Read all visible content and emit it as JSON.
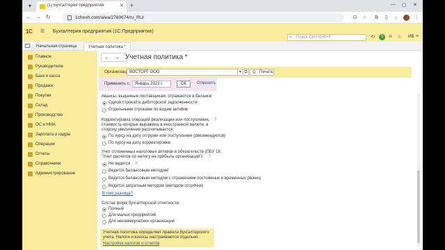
{
  "browser": {
    "tab_title": "(1) Бухгалтерия предприятия",
    "url": "1cfresh.com/a/ea/2780674/ru_RU/"
  },
  "app": {
    "logo": "1С",
    "title": "Бухгалтерия предприятия (1С:Предприятие)",
    "search_placeholder": "Поиск Ctrl+Shift+F",
    "notifications_count": "9",
    "user": "ИВ"
  },
  "tabs": [
    {
      "label": "Начальная страница"
    },
    {
      "label": "Учетная политика *"
    }
  ],
  "sidebar": {
    "items": [
      {
        "label": "Главное"
      },
      {
        "label": "Руководителю"
      },
      {
        "label": "Банк и касса"
      },
      {
        "label": "Продажи"
      },
      {
        "label": "Покупки"
      },
      {
        "label": "Склад"
      },
      {
        "label": "Производство"
      },
      {
        "label": "ОС и НМА"
      },
      {
        "label": "Зарплата и кадры"
      },
      {
        "label": "Операции"
      },
      {
        "label": "Отчеты"
      },
      {
        "label": "Справочники"
      },
      {
        "label": "Администрирование"
      }
    ]
  },
  "form": {
    "title": "Учетная политика *",
    "org_label": "Организация:",
    "org_value": "ВОСТОРГ ООО",
    "print_label": "Печать",
    "apply_label": "Применить с:",
    "apply_value": "Январь 2023 г.",
    "ok_label": "ОК",
    "cancel_label": "Отменить",
    "advances": {
      "title": "Авансы, выданные поставщикам, отражаются в балансе:",
      "options": [
        "Одной строкой в дебиторской задолженности",
        "Отдельными строками по видам активов"
      ]
    },
    "fx": {
      "title": "Корректировка операций реализации или поступления, стоимость которых выражена в иностранной валюте, в сторону увеличения рассчитывается:",
      "options": [
        "По курсу на дату отгрузки или поступления (рекомендуется)",
        "По курсу на дату корректировки"
      ]
    },
    "tax": {
      "title": "Учет отложенных налоговых активов и обязательств (ПБУ 18 \"Учет расчетов по налогу на прибыль организаций\"):",
      "options": [
        "Не ведется",
        "Ведется балансовым методом",
        "Ведется балансовым методом с отражением постоянных и временных разниц",
        "Ведется затратным методом (методом отсрочки)"
      ],
      "link": "В чем разница?"
    },
    "reports": {
      "title": "Состав форм бухгалтерской отчетности:",
      "options": [
        "Полный",
        "Для малых предприятий",
        "Для некоммерческих организаций"
      ]
    },
    "info": {
      "text": "Учетная политика определяет правила бухгалтерского учета. Налоги и взносы настраиваются отдельно.",
      "link": "Настройка налогов и отчетов"
    }
  }
}
